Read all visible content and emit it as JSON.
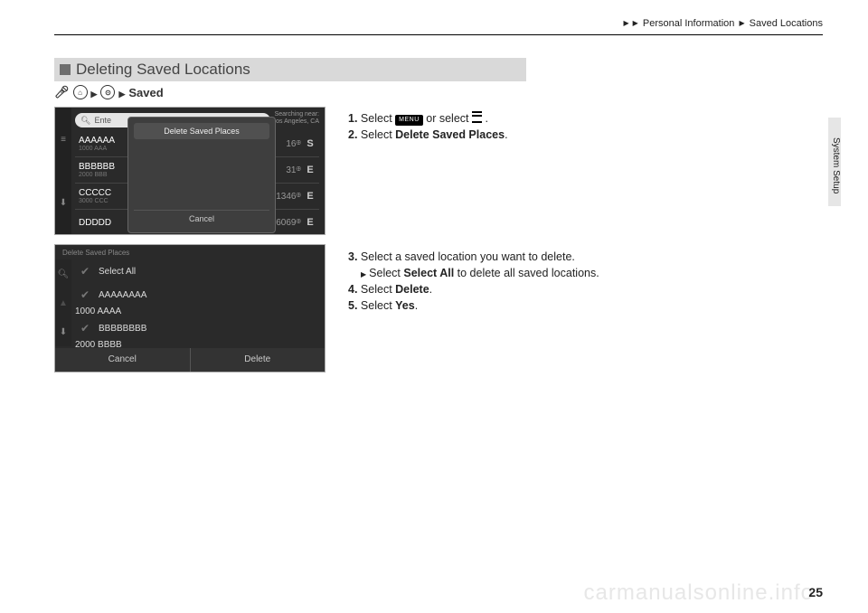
{
  "breadcrumb": {
    "p1": "Personal Information",
    "p2": "Saved Locations"
  },
  "side_tab": "System Setup",
  "section_title": "Deleting Saved Locations",
  "nav_trail": {
    "saved": "Saved"
  },
  "instructions": {
    "s1_pre": "Select ",
    "s1_menu": "MENU",
    "s1_mid": " or select ",
    "s1_post": ".",
    "s2": "Select ",
    "s2b": "Delete Saved Places",
    "s3": "Select a saved location you want to delete.",
    "s3sub_a": "Select ",
    "s3sub_b": "Select All",
    "s3sub_c": " to delete all saved locations.",
    "s4": "Select ",
    "s4b": "Delete",
    "s5": "Select ",
    "s5b": "Yes"
  },
  "shot1": {
    "search_placeholder": "Ente",
    "near1": "Searching near:",
    "near2": "Los Angeles, CA",
    "rows": [
      {
        "name": "AAAAAA",
        "sub": "1000 AAA",
        "dist": "16",
        "unit": "",
        "dir": "S"
      },
      {
        "name": "BBBBBB",
        "sub": "2000 BBB",
        "dist": "31",
        "unit": "",
        "dir": "E"
      },
      {
        "name": "CCCCC",
        "sub": "3000 CCC",
        "dist": "1346",
        "unit": "",
        "dir": "E"
      },
      {
        "name": "DDDDD",
        "sub": "",
        "dist": "6069",
        "unit": "",
        "dir": "E"
      }
    ],
    "popup_title": "Delete Saved Places",
    "popup_cancel": "Cancel"
  },
  "shot2": {
    "title": "Delete Saved Places",
    "select_all": "Select All",
    "rows": [
      {
        "name": "AAAAAAAA",
        "sub": "1000 AAAA"
      },
      {
        "name": "BBBBBBBB",
        "sub": "2000 BBBB"
      }
    ],
    "cancel": "Cancel",
    "delete": "Delete"
  },
  "page_number": "25",
  "watermark": "carmanualsonline.info"
}
